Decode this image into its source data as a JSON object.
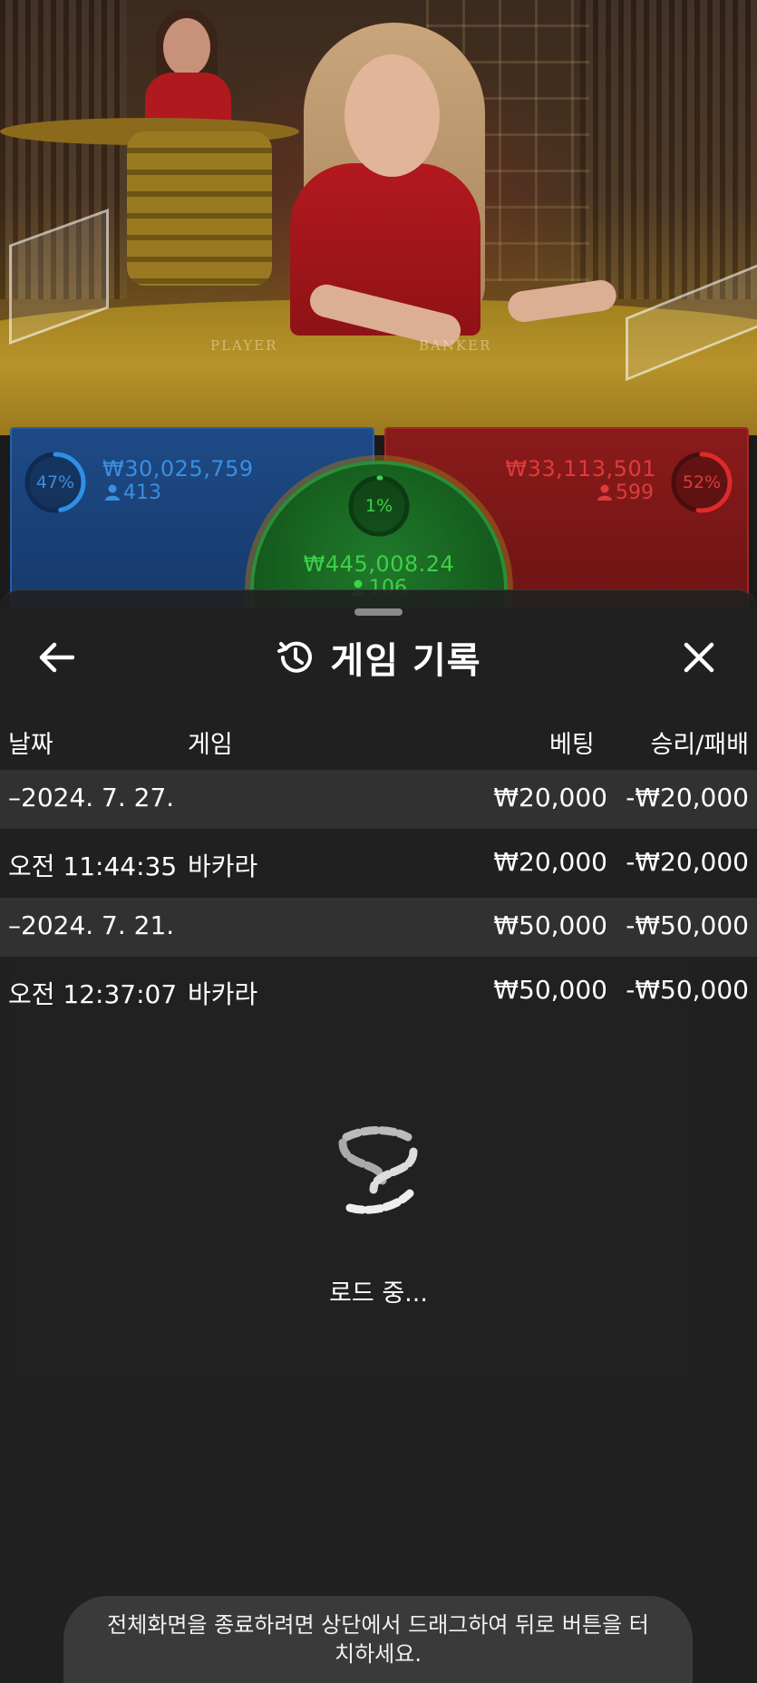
{
  "player": {
    "percent": "47%",
    "amount": "₩30,025,759",
    "count": "413"
  },
  "banker": {
    "percent": "52%",
    "amount": "₩33,113,501",
    "count": "599"
  },
  "tie": {
    "percent": "1%",
    "amount": "₩445,008.24",
    "count": "106"
  },
  "table_text": {
    "player": "PLAYER",
    "banker": "BANKER"
  },
  "sheet": {
    "title": "게임 기록",
    "columns": {
      "date": "날짜",
      "game": "게임",
      "bet": "베팅",
      "winloss": "승리/패배"
    },
    "rows": [
      {
        "type": "date",
        "date": "–2024. 7. 27.",
        "bet": "₩20,000",
        "winloss": "-₩20,000"
      },
      {
        "type": "item",
        "time": "오전 11:44:35",
        "game": "바카라",
        "bet": "₩20,000",
        "winloss": "-₩20,000"
      },
      {
        "type": "date",
        "date": "–2024. 7. 21.",
        "bet": "₩50,000",
        "winloss": "-₩50,000"
      },
      {
        "type": "item",
        "time": "오전 12:37:07",
        "game": "바카라",
        "bet": "₩50,000",
        "winloss": "-₩50,000"
      }
    ],
    "loading": "로드 중..."
  },
  "toast": "전체화면을 종료하려면 상단에서 드래그하여 뒤로 버튼을 터치하세요.",
  "icons": {
    "back": "arrow-left-icon",
    "close": "close-icon",
    "history": "history-icon",
    "spinner": "loading-spinner-icon",
    "person": "person-icon"
  },
  "colors": {
    "player": "#2f7fd6",
    "banker": "#d02626",
    "tie": "#2fbf3a"
  }
}
